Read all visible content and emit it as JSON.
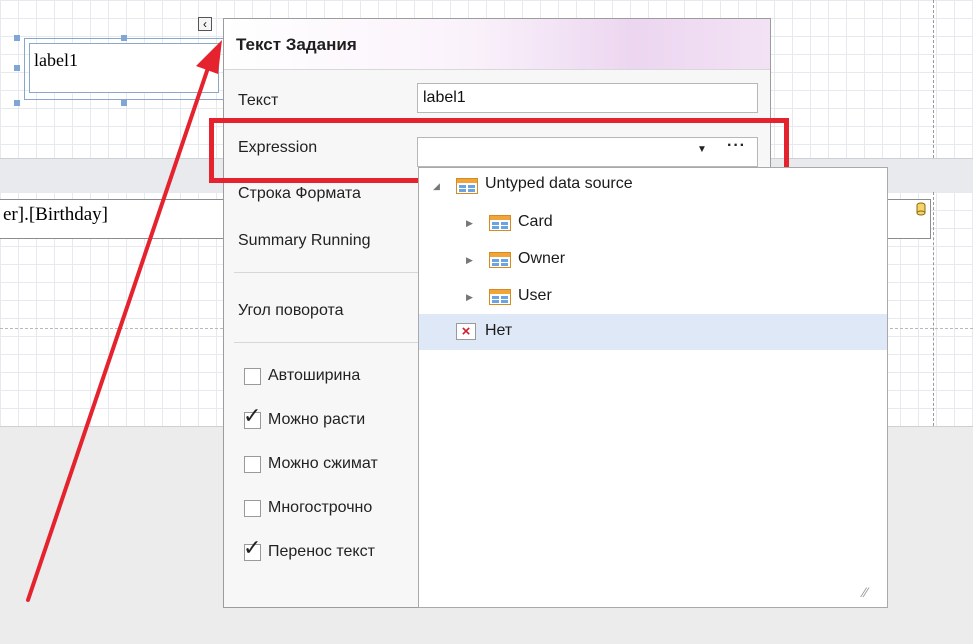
{
  "report": {
    "label_text": "label1",
    "birthday_field": "er].[Birthday]"
  },
  "panel": {
    "title": "Текст Задания",
    "text_label": "Текст",
    "text_value": "label1",
    "expression_label": "Expression",
    "expression_value": "",
    "format_label": "Строка Формата",
    "summary_label": "Summary Running",
    "rotation_label": "Угол поворота",
    "checkboxes": [
      {
        "label": "Автоширина",
        "checked": false
      },
      {
        "label": "Можно расти",
        "checked": true
      },
      {
        "label": "Можно сжимат",
        "checked": false
      },
      {
        "label": "Многострочно",
        "checked": false
      },
      {
        "label": "Перенос текст",
        "checked": true
      }
    ]
  },
  "dropdown": {
    "root": "Untyped data source",
    "items": [
      "Card",
      "Owner",
      "User"
    ],
    "none_label": "Нет"
  },
  "icons": {
    "collapse": "chevron-left-icon",
    "dropdown_arrow": "chevron-down-icon",
    "ellipsis": "ellipsis-icon",
    "table": "table-icon",
    "none": "x-icon",
    "database": "database-icon"
  },
  "colors": {
    "highlight": "#e5232e",
    "selected_row": "#dfe8f7",
    "grid": "#e6e9ee"
  }
}
